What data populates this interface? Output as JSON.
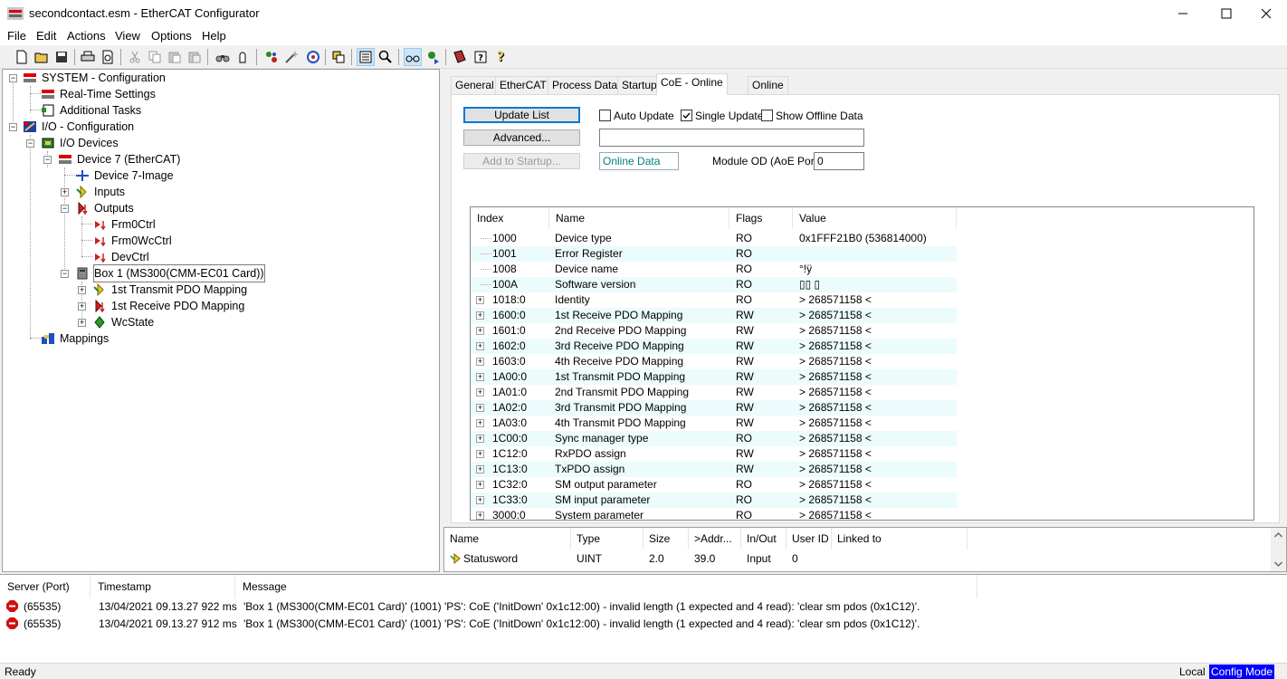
{
  "window": {
    "title": "secondcontact.esm - EtherCAT Configurator"
  },
  "menu": [
    "File",
    "Edit",
    "Actions",
    "View",
    "Options",
    "Help"
  ],
  "toolbar_icons": [
    "new-icon",
    "open-icon",
    "save-icon",
    "print-icon",
    "print-preview-icon",
    "cut-icon",
    "copy-icon",
    "paste-icon",
    "paste-with-links-icon",
    "find-icon",
    "find-next-icon",
    "insert-device-icon",
    "delete-device-icon",
    "scan-icon",
    "generate-mappings-icon",
    "check-icon",
    "activate-icon",
    "tree-view-icon",
    "zoom-icon",
    "online-icon",
    "freerun-icon",
    "show-messages-icon",
    "about-icon",
    "help-icon"
  ],
  "tree": {
    "system": "SYSTEM - Configuration",
    "realtime": "Real-Time Settings",
    "tasks": "Additional Tasks",
    "io": "I/O - Configuration",
    "devices": "I/O Devices",
    "device7": "Device 7 (EtherCAT)",
    "device7image": "Device 7-Image",
    "inputs": "Inputs",
    "outputs": "Outputs",
    "frm0ctrl": "Frm0Ctrl",
    "frm0wcctrl": "Frm0WcCtrl",
    "devctrl": "DevCtrl",
    "box1": "Box 1 (MS300(CMM-EC01 Card))",
    "txpdo": "1st Transmit PDO Mapping",
    "rxpdo": "1st Receive PDO Mapping",
    "wcstate": "WcState",
    "mappings": "Mappings"
  },
  "tabs": [
    "General",
    "EtherCAT",
    "Process Data",
    "Startup",
    "CoE - Online",
    "Online"
  ],
  "coe": {
    "update_list": "Update List",
    "advanced": "Advanced...",
    "add_to_startup": "Add to Startup...",
    "auto_update": "Auto Update",
    "single_update": "Single Update",
    "show_offline": "Show Offline Data",
    "status_text": "",
    "online_data": "Online Data",
    "module_od_label": "Module OD (AoE Port):",
    "module_od_value": "0"
  },
  "od_columns": [
    "Index",
    "Name",
    "Flags",
    "Value"
  ],
  "od_rows": [
    {
      "index": "1000",
      "name": "Device type",
      "flags": "RO",
      "value": "0x1FFF21B0 (536814000)",
      "exp": false
    },
    {
      "index": "1001",
      "name": "Error Register",
      "flags": "RO",
      "value": "",
      "exp": false
    },
    {
      "index": "1008",
      "name": "Device name",
      "flags": "RO",
      "value": "°!ÿ",
      "exp": false
    },
    {
      "index": "100A",
      "name": "Software version",
      "flags": "RO",
      "value": "▯▯ ▯",
      "exp": false
    },
    {
      "index": "1018:0",
      "name": "Identity",
      "flags": "RO",
      "value": "> 268571158 <",
      "exp": true
    },
    {
      "index": "1600:0",
      "name": "1st Receive PDO Mapping",
      "flags": "RW",
      "value": "> 268571158 <",
      "exp": true
    },
    {
      "index": "1601:0",
      "name": "2nd Receive PDO Mapping",
      "flags": "RW",
      "value": "> 268571158 <",
      "exp": true
    },
    {
      "index": "1602:0",
      "name": "3rd Receive PDO Mapping",
      "flags": "RW",
      "value": "> 268571158 <",
      "exp": true
    },
    {
      "index": "1603:0",
      "name": "4th Receive PDO Mapping",
      "flags": "RW",
      "value": "> 268571158 <",
      "exp": true
    },
    {
      "index": "1A00:0",
      "name": "1st Transmit PDO Mapping",
      "flags": "RW",
      "value": "> 268571158 <",
      "exp": true
    },
    {
      "index": "1A01:0",
      "name": "2nd Transmit PDO Mapping",
      "flags": "RW",
      "value": "> 268571158 <",
      "exp": true
    },
    {
      "index": "1A02:0",
      "name": "3rd Transmit PDO Mapping",
      "flags": "RW",
      "value": "> 268571158 <",
      "exp": true
    },
    {
      "index": "1A03:0",
      "name": "4th Transmit PDO Mapping",
      "flags": "RW",
      "value": "> 268571158 <",
      "exp": true
    },
    {
      "index": "1C00:0",
      "name": "Sync manager type",
      "flags": "RO",
      "value": "> 268571158 <",
      "exp": true
    },
    {
      "index": "1C12:0",
      "name": "RxPDO assign",
      "flags": "RW",
      "value": "> 268571158 <",
      "exp": true
    },
    {
      "index": "1C13:0",
      "name": "TxPDO assign",
      "flags": "RW",
      "value": "> 268571158 <",
      "exp": true
    },
    {
      "index": "1C32:0",
      "name": "SM output parameter",
      "flags": "RO",
      "value": "> 268571158 <",
      "exp": true
    },
    {
      "index": "1C33:0",
      "name": "SM input parameter",
      "flags": "RO",
      "value": "> 268571158 <",
      "exp": true
    },
    {
      "index": "3000:0",
      "name": "System parameter",
      "flags": "RO",
      "value": "> 268571158 <",
      "exp": true
    }
  ],
  "var_columns": [
    "Name",
    "Type",
    "Size",
    ">Addr...",
    "In/Out",
    "User ID",
    "Linked to"
  ],
  "var_row": {
    "name": "Statusword",
    "type": "UINT",
    "size": "2.0",
    "addr": "39.0",
    "inout": "Input",
    "userid": "0",
    "linked": ""
  },
  "msg_columns": [
    "Server (Port)",
    "Timestamp",
    "Message"
  ],
  "messages": [
    {
      "port": "(65535)",
      "time": "13/04/2021 09.13.27 922 ms",
      "text": "'Box 1 (MS300(CMM-EC01 Card)' (1001) 'PS': CoE ('InitDown' 0x1c12:00) - invalid length (1 expected and 4 read): 'clear sm pdos (0x1C12)'."
    },
    {
      "port": "(65535)",
      "time": "13/04/2021 09.13.27 912 ms",
      "text": "'Box 1 (MS300(CMM-EC01 Card)' (1001) 'PS': CoE ('InitDown' 0x1c12:00) - invalid length (1 expected and 4 read): 'clear sm pdos (0x1C12)'."
    }
  ],
  "status": {
    "left": "Ready",
    "local": "Local",
    "mode": "Config Mode"
  }
}
